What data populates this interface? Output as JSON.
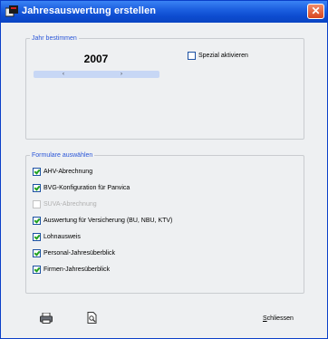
{
  "window": {
    "title": "Jahresauswertung erstellen",
    "close_glyph": "✕"
  },
  "year_group": {
    "legend": "Jahr bestimmen",
    "year": "2007",
    "prev_glyph": "‹",
    "next_glyph": "›",
    "special": {
      "label": "Spezial aktivieren",
      "checked": false
    }
  },
  "forms_group": {
    "legend": "Formulare auswählen",
    "items": [
      {
        "label": "AHV-Abrechnung",
        "checked": true,
        "enabled": true
      },
      {
        "label": "BVG-Konfiguration für Panvica",
        "checked": true,
        "enabled": true
      },
      {
        "label": "SUVA-Abrechnung",
        "checked": false,
        "enabled": false
      },
      {
        "label": "Auswertung für Versicherung (BU, NBU, KTV)",
        "checked": true,
        "enabled": true
      },
      {
        "label": "Lohnausweis",
        "checked": true,
        "enabled": true
      },
      {
        "label": "Personal-Jahresüberblick",
        "checked": true,
        "enabled": true
      },
      {
        "label": "Firmen-Jahresüberblick",
        "checked": true,
        "enabled": true
      }
    ]
  },
  "footer": {
    "print_icon": "printer-icon",
    "preview_icon": "print-preview-icon",
    "close_label_first": "S",
    "close_label_rest": "chliessen"
  },
  "colors": {
    "titlebar": "#0a45c2",
    "legend_text": "#2a56d8",
    "check_mark": "#21a121"
  }
}
